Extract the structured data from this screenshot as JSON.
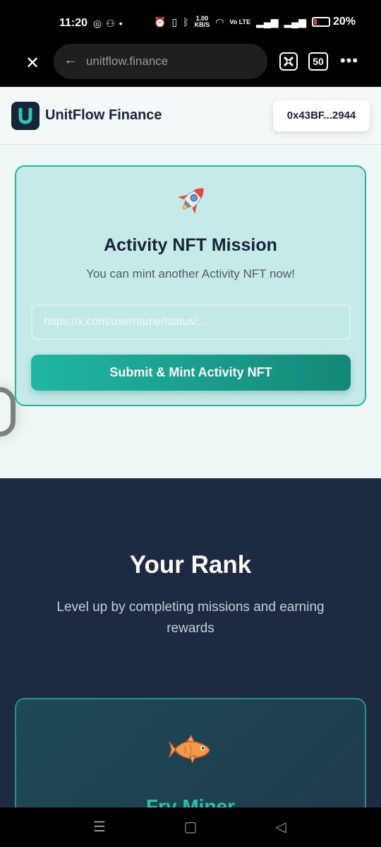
{
  "status_bar": {
    "time": "11:20",
    "net_speed_value": "1.00",
    "net_speed_unit": "KB/S",
    "volte_label": "Vo LTE",
    "battery_percent": "20%",
    "battery_level": 0.2,
    "battery_color": "#e23b3b",
    "left_icons": [
      "instagram-icon",
      "game-controller-icon",
      "dot-icon"
    ],
    "right_icons": [
      "alarm-icon",
      "vibrate-icon",
      "bluetooth-icon",
      "wifi-icon",
      "wifi-calling-icon",
      "signal-icon",
      "signal-icon"
    ]
  },
  "browser": {
    "url": "unitflow.finance",
    "tab_count": "50"
  },
  "site": {
    "brand": "UnitFlow Finance",
    "wallet": "0x43BF...2944",
    "accent_color": "#27b3a1",
    "navy_color": "#17253b"
  },
  "mission": {
    "title": "Activity NFT Mission",
    "subtitle": "You can mint another Activity NFT now!",
    "input_placeholder": "https://x.com/username/status/...",
    "button_label": "Submit & Mint Activity NFT"
  },
  "rank": {
    "title": "Your Rank",
    "subtitle": "Level up by completing missions and earning rewards",
    "card_name": "Fry Miner"
  }
}
